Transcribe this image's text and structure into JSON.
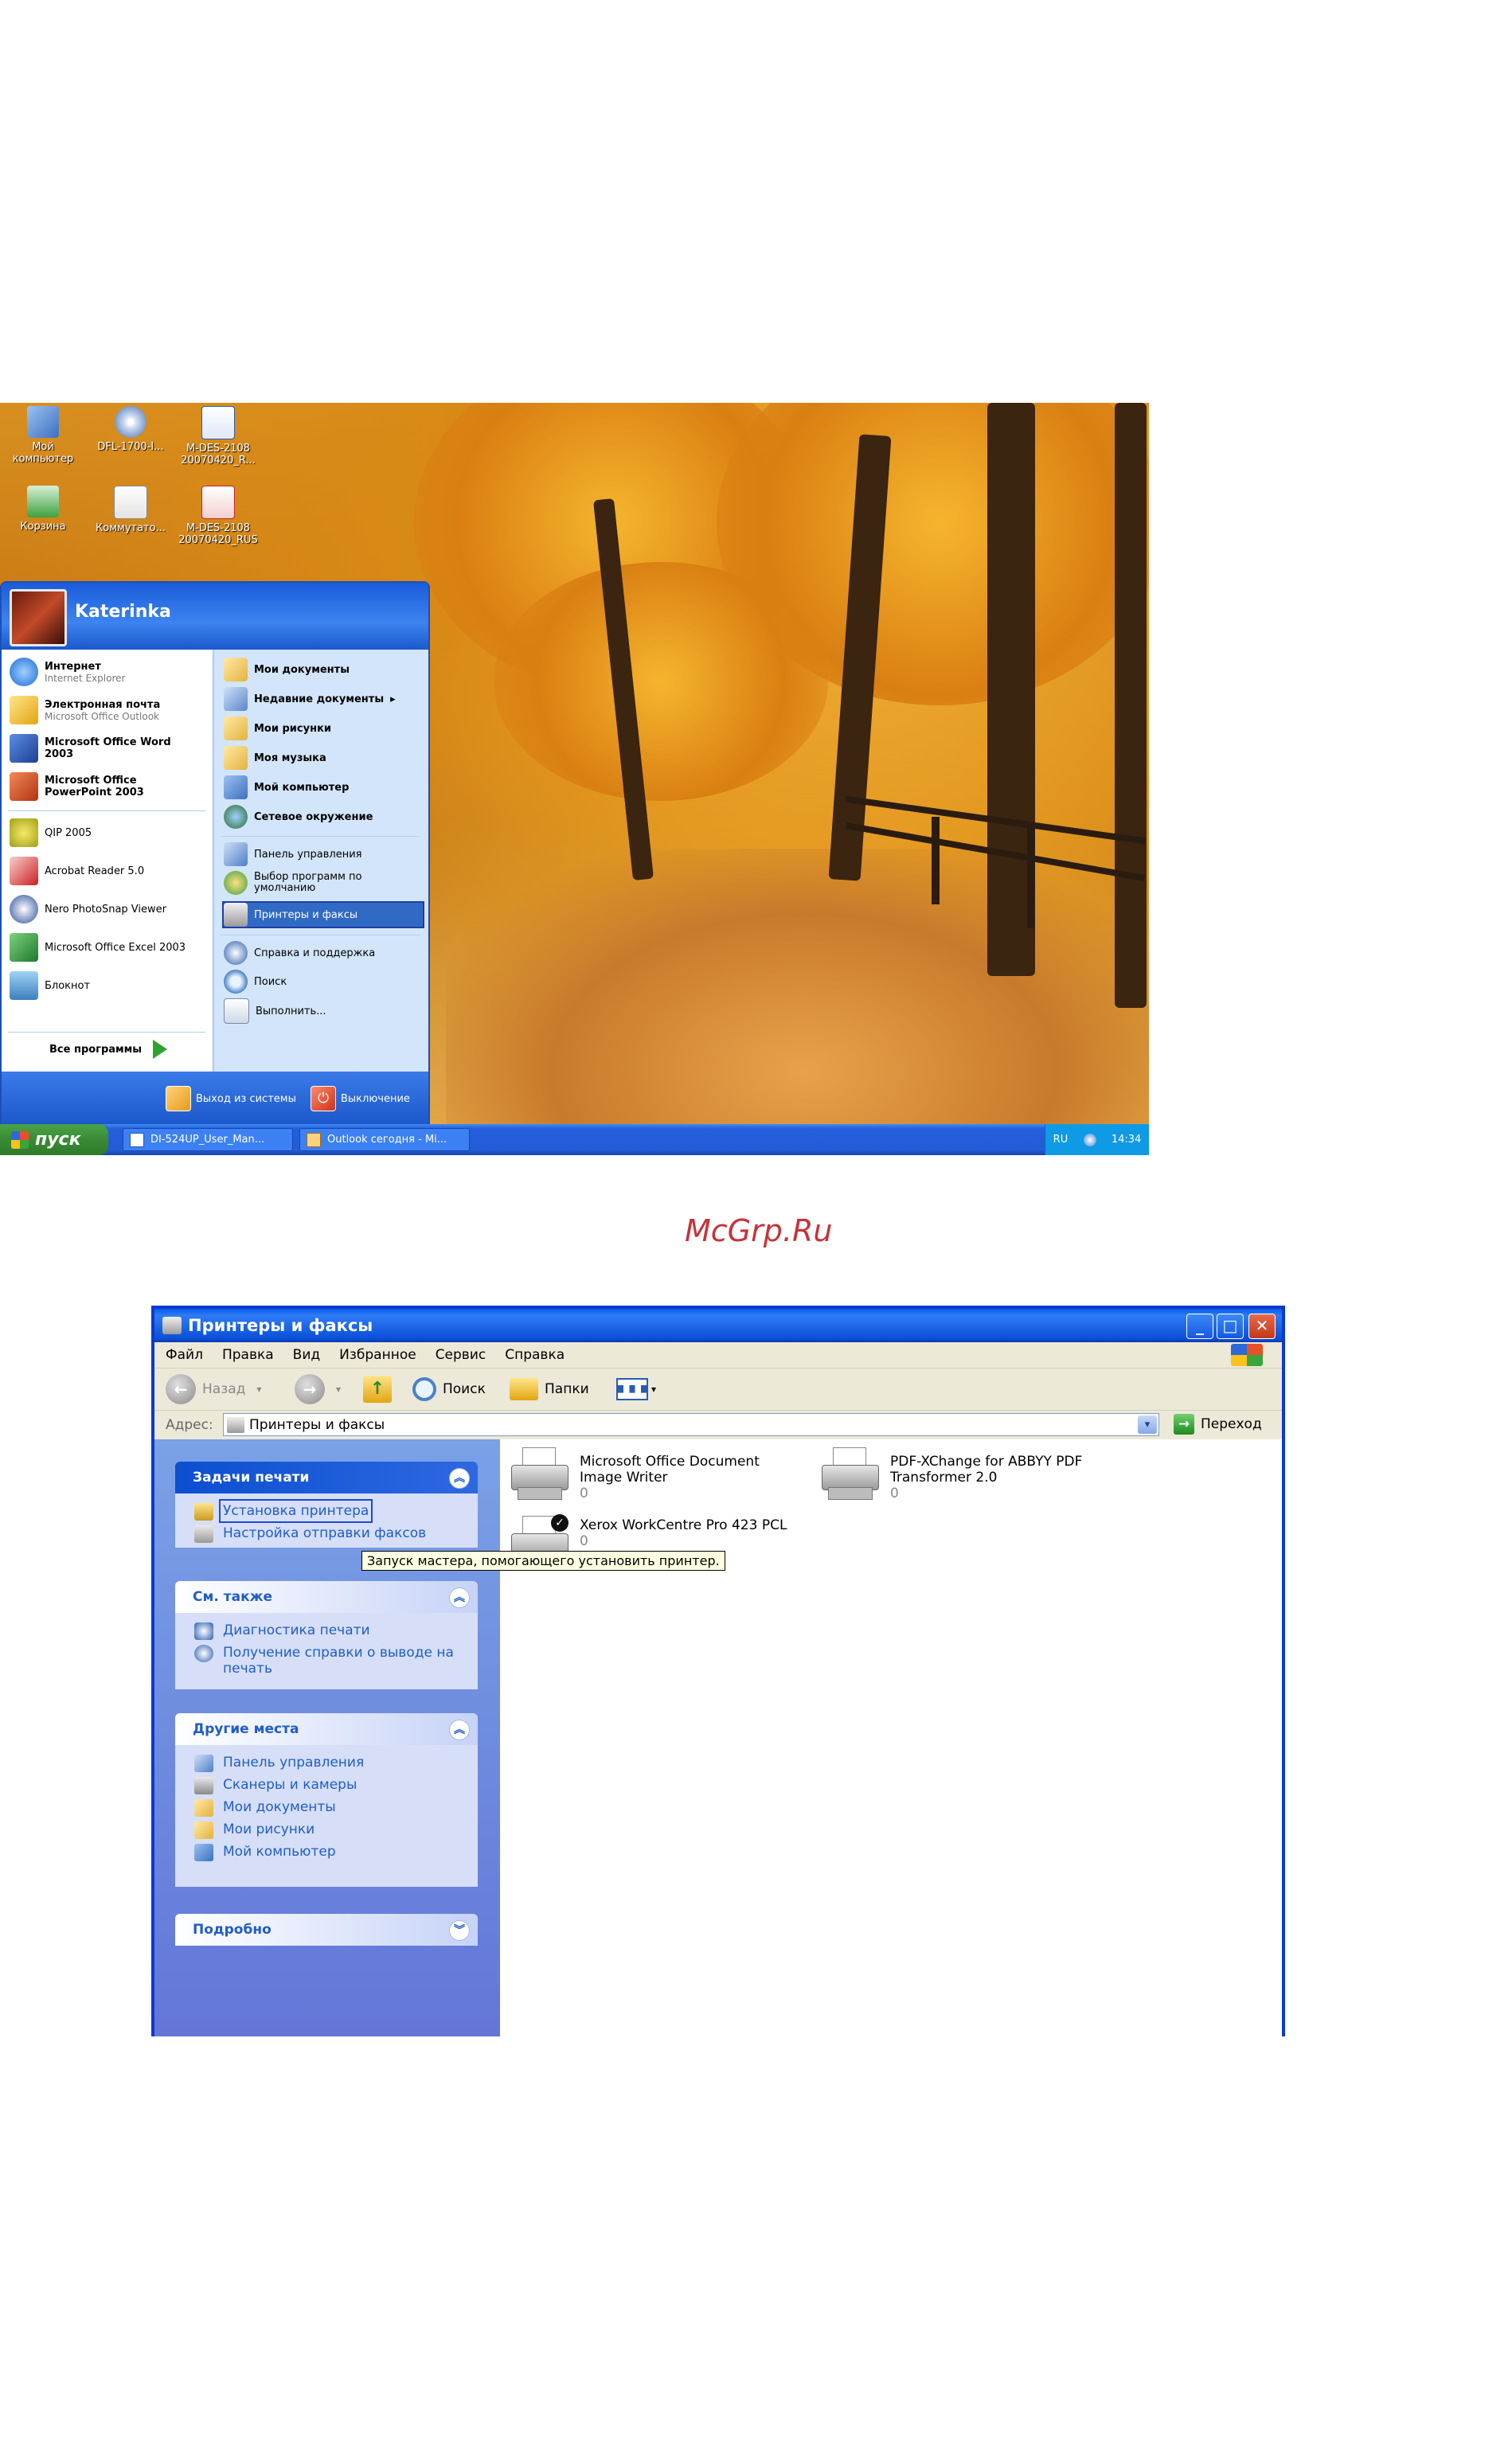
{
  "desktop": {
    "icons": [
      {
        "label": "Мой компьютер",
        "icon": "my-computer-icon"
      },
      {
        "label": "DFL-1700-I...",
        "icon": "cd-icon"
      },
      {
        "label": "M-DES-2108 20070420_R...",
        "icon": "word-doc-icon"
      },
      {
        "label": "Корзина",
        "icon": "recycle-bin-icon"
      },
      {
        "label": "Коммутато...",
        "icon": "document-icon"
      },
      {
        "label": "M-DES-2108 20070420_RUS",
        "icon": "pdf-icon"
      }
    ],
    "start_menu": {
      "user": "Katerinka",
      "pinned": [
        {
          "title": "Интернет",
          "subtitle": "Internet Explorer",
          "icon": "internet-explorer-icon"
        },
        {
          "title": "Электронная почта",
          "subtitle": "Microsoft Office Outlook",
          "icon": "outlook-icon"
        },
        {
          "title": "Microsoft Office Word 2003",
          "subtitle": "",
          "icon": "word-icon"
        },
        {
          "title": "Microsoft Office PowerPoint 2003",
          "subtitle": "",
          "icon": "powerpoint-icon"
        }
      ],
      "recent": [
        {
          "label": "QIP 2005",
          "icon": "qip-icon"
        },
        {
          "label": "Acrobat Reader 5.0",
          "icon": "acrobat-icon"
        },
        {
          "label": "Nero PhotoSnap Viewer",
          "icon": "nero-icon"
        },
        {
          "label": "Microsoft Office Excel 2003",
          "icon": "excel-icon"
        },
        {
          "label": "Блокнот",
          "icon": "notepad-icon"
        }
      ],
      "all_programs": "Все программы",
      "right_items": [
        {
          "label": "Мои документы",
          "icon": "my-documents-icon"
        },
        {
          "label": "Недавние документы",
          "icon": "recent-documents-icon"
        },
        {
          "label": "Мои рисунки",
          "icon": "my-pictures-icon"
        },
        {
          "label": "Моя музыка",
          "icon": "my-music-icon"
        },
        {
          "label": "Мой компьютер",
          "icon": "my-computer-icon"
        },
        {
          "label": "Сетевое окружение",
          "icon": "network-icon"
        }
      ],
      "right_items2": [
        {
          "label": "Панель управления",
          "icon": "control-panel-icon"
        },
        {
          "label": "Выбор программ по умолчанию",
          "icon": "default-programs-icon"
        },
        {
          "label": "Принтеры и факсы",
          "icon": "printers-icon"
        }
      ],
      "right_items3": [
        {
          "label": "Справка и поддержка",
          "icon": "help-icon"
        },
        {
          "label": "Поиск",
          "icon": "search-icon"
        },
        {
          "label": "Выполнить...",
          "icon": "run-icon"
        }
      ],
      "logoff": "Выход из системы",
      "shutdown": "Выключение"
    },
    "taskbar": {
      "start_label": "пуск",
      "buttons": [
        "DI-524UP_User_Man...",
        "Outlook сегодня - Mi..."
      ],
      "lang": "RU",
      "clock": "14:34"
    }
  },
  "watermark": "McGrp.Ru",
  "explorer": {
    "title": "Принтеры и факсы",
    "menu": [
      "Файл",
      "Правка",
      "Вид",
      "Избранное",
      "Сервис",
      "Справка"
    ],
    "toolbar": {
      "back": "Назад",
      "search": "Поиск",
      "folders": "Папки"
    },
    "address": {
      "label": "Адрес:",
      "value": "Принтеры и факсы",
      "go": "Переход"
    },
    "panels": {
      "tasks": {
        "title": "Задачи печати",
        "links": [
          {
            "label": "Установка принтера",
            "icon": "add-printer-icon"
          },
          {
            "label": "Настройка отправки факсов",
            "icon": "fax-setup-icon"
          }
        ]
      },
      "see_also": {
        "title": "См. также",
        "links": [
          {
            "label": "Диагностика печати",
            "icon": "help-icon"
          },
          {
            "label": "Получение справки о выводе на печать",
            "icon": "help-icon"
          }
        ]
      },
      "other": {
        "title": "Другие места",
        "links": [
          {
            "label": "Панель управления",
            "icon": "control-panel-icon"
          },
          {
            "label": "Сканеры и камеры",
            "icon": "scanner-icon"
          },
          {
            "label": "Мои документы",
            "icon": "my-documents-icon"
          },
          {
            "label": "Мои рисунки",
            "icon": "my-pictures-icon"
          },
          {
            "label": "Мой компьютер",
            "icon": "my-computer-icon"
          }
        ]
      },
      "details": {
        "title": "Подробно"
      }
    },
    "tooltip": "Запуск мастера, помогающего установить принтер.",
    "printers": [
      {
        "name": "Microsoft Office Document Image Writer",
        "status": "0"
      },
      {
        "name": "PDF-XChange for ABBYY PDF Transformer 2.0",
        "status": "0"
      },
      {
        "name": "Xerox WorkCentre Pro 423 PCL",
        "status": "0",
        "default": true
      }
    ]
  },
  "colors": {
    "xp_blue": "#0a3bd0",
    "link": "#215dc6",
    "selection": "#316ac5",
    "start_green": "#3a8b35"
  }
}
